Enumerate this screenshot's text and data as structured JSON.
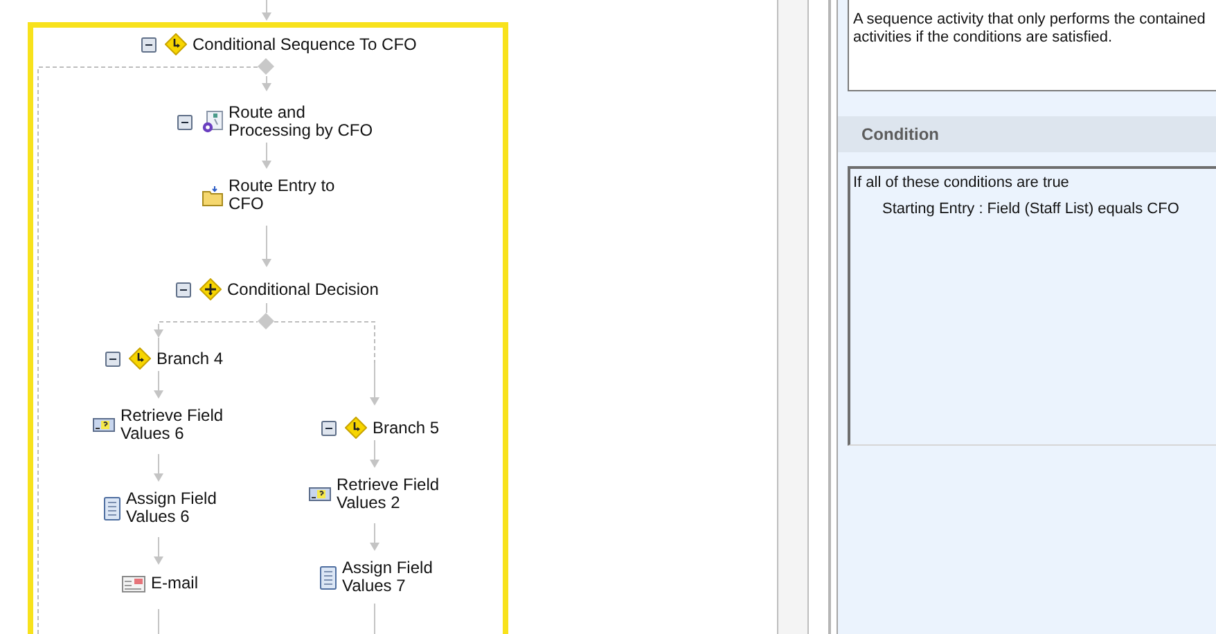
{
  "diagram": {
    "nodes": [
      {
        "kind": "conditional",
        "label": "Conditional Sequence To CFO",
        "expanded": true,
        "selected": true,
        "children": [
          {
            "kind": "process",
            "label": "Route and Processing by CFO",
            "expanded": true,
            "selected": false,
            "children": [
              {
                "kind": "folder",
                "label": "Route Entry to CFO",
                "selected": false
              }
            ]
          },
          {
            "kind": "decision",
            "label": "Conditional Decision",
            "expanded": true,
            "selected": false,
            "children": [
              {
                "kind": "conditional",
                "label": "Branch 4",
                "expanded": true,
                "selected": false,
                "children": [
                  {
                    "kind": "retrieve",
                    "label": "Retrieve Field Values 6",
                    "selected": false
                  },
                  {
                    "kind": "assign",
                    "label": "Assign Field Values 6",
                    "selected": false
                  },
                  {
                    "kind": "email",
                    "label": "E-mail",
                    "selected": false
                  }
                ]
              },
              {
                "kind": "conditional",
                "label": "Branch 5",
                "expanded": true,
                "selected": false,
                "children": [
                  {
                    "kind": "retrieve",
                    "label": "Retrieve Field Values 2",
                    "selected": false
                  },
                  {
                    "kind": "assign",
                    "label": "Assign Field Values 7",
                    "selected": false
                  }
                ]
              }
            ]
          }
        ]
      }
    ]
  },
  "properties": {
    "description": "A sequence activity that only performs the contained activities if the conditions are satisfied.",
    "section_title": "Condition",
    "condition": {
      "heading": "If all of these conditions are true",
      "items": [
        "Starting Entry : Field (Staff List) equals CFO"
      ]
    }
  }
}
